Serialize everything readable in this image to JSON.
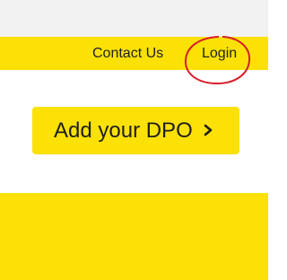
{
  "header": {
    "contact_label": "Contact Us",
    "login_label": "Login"
  },
  "cta": {
    "label": "Add your DPO",
    "icon": "chevron-right-icon"
  },
  "colors": {
    "brand_yellow": "#fbe106",
    "top_strip": "#f2f2f2",
    "annotation_red": "#d81e2a"
  }
}
